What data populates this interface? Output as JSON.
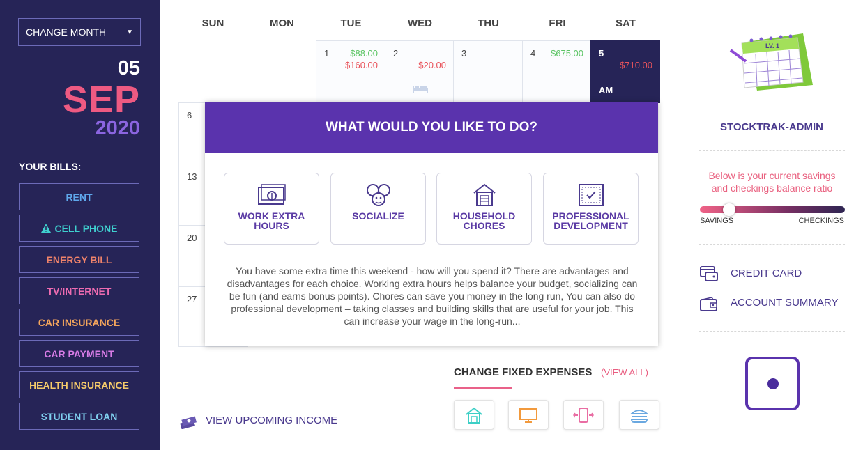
{
  "sidebar": {
    "change_month": "CHANGE MONTH",
    "day": "05",
    "month": "SEP",
    "year": "2020",
    "bills_heading": "YOUR BILLS:",
    "bills": [
      {
        "label": "RENT",
        "color": "#5fa8ec"
      },
      {
        "label": "CELL PHONE",
        "color": "#3fd0cf",
        "warning": true
      },
      {
        "label": "ENERGY BILL",
        "color": "#f0836a"
      },
      {
        "label": "TV/INTERNET",
        "color": "#ee6bb1"
      },
      {
        "label": "CAR INSURANCE",
        "color": "#f4a55c"
      },
      {
        "label": "CAR PAYMENT",
        "color": "#d77ce6"
      },
      {
        "label": "HEALTH INSURANCE",
        "color": "#f6cb6a"
      },
      {
        "label": "STUDENT LOAN",
        "color": "#7fcfee"
      }
    ]
  },
  "calendar": {
    "weekdays": [
      "SUN",
      "MON",
      "TUE",
      "WED",
      "THU",
      "FRI",
      "SAT"
    ],
    "week1": [
      {
        "day": "1",
        "income": "$88.00",
        "expense": "$160.00"
      },
      {
        "day": "2",
        "income": "",
        "expense": "$20.00"
      },
      {
        "day": "3",
        "income": "",
        "expense": ""
      },
      {
        "day": "4",
        "income": "$675.00",
        "expense": ""
      },
      {
        "day": "5",
        "income": "",
        "expense": "$710.00",
        "note": "AM"
      }
    ],
    "sundays": [
      "6",
      "13",
      "20",
      "27"
    ]
  },
  "modal": {
    "title": "WHAT WOULD YOU LIKE TO DO?",
    "options": [
      {
        "line1": "WORK EXTRA",
        "line2": "HOURS"
      },
      {
        "line1": "SOCIALIZE",
        "line2": ""
      },
      {
        "line1": "HOUSEHOLD",
        "line2": "CHORES"
      },
      {
        "line1": "PROFESSIONAL",
        "line2": "DEVELOPMENT"
      }
    ],
    "text": "You have some extra time this weekend - how will you spend it? There are advantages and disadvantages for each choice. Working extra hours helps balance your budget, socializing can be fun (and earns bonus points). Chores can save you money in the long run, You can also do professional development – taking classes and building skills that are useful for your job. This can increase your wage in the long-run..."
  },
  "bottom": {
    "change_fixed_expenses": "CHANGE FIXED EXPENSES",
    "view_all": "(VIEW ALL)",
    "view_upcoming_income": "VIEW UPCOMING INCOME"
  },
  "right": {
    "calendar_badge": "LV. 1",
    "username": "STOCKTRAK-ADMIN",
    "ratio_text": "Below is your current savings and checkings balance ratio",
    "savings_label": "SAVINGS",
    "checkings_label": "CHECKINGS",
    "savings_ratio": 0.2,
    "credit_card": "CREDIT CARD",
    "account_summary": "ACCOUNT SUMMARY"
  }
}
